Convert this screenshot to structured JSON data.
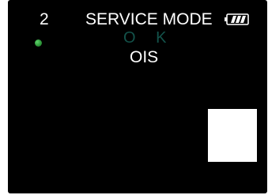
{
  "screen": {
    "mode_number": "2",
    "mode_title": "SERVICE MODE",
    "status_text": "O K",
    "sub_title": "OIS",
    "status_indicator": "green",
    "battery_icon": "battery-full-icon",
    "battery_level": 1.0
  },
  "colors": {
    "background": "#000000",
    "text": "#ffffff",
    "status_text": "#13524a",
    "indicator": "#2f9a3b"
  }
}
